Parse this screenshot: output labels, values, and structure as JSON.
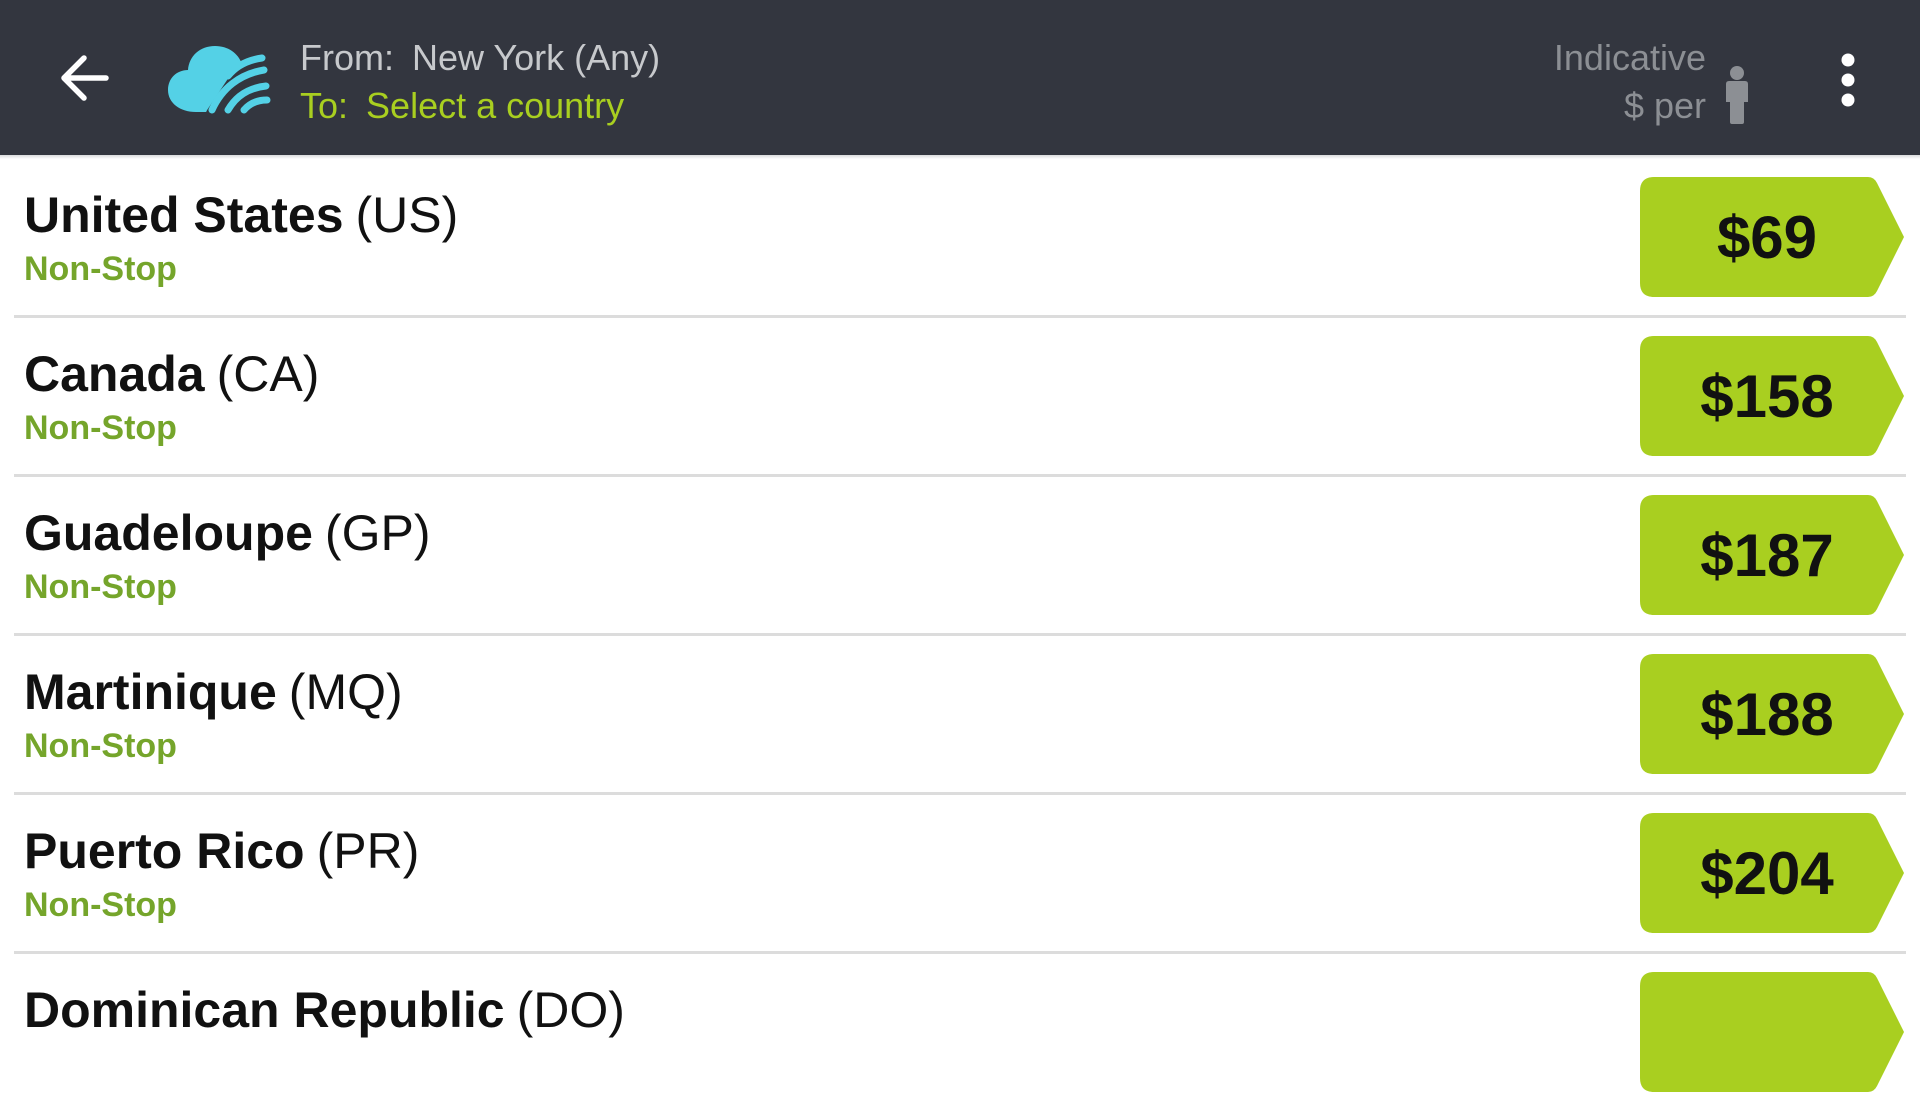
{
  "header": {
    "from_label": "From:",
    "from_value": "New York (Any)",
    "to_label": "To:",
    "to_value": "Select a country",
    "indicative_line1": "Indicative",
    "indicative_line2": "$ per",
    "icons": {
      "back": "arrow-back-icon",
      "logo": "skyscanner-cloud-logo",
      "person": "person-icon",
      "menu": "more-vertical-icon"
    }
  },
  "colors": {
    "appbar": "#33363f",
    "accent_green": "#a9cf20",
    "stop_green": "#75a52b",
    "logo_cyan": "#54d1e6"
  },
  "destinations": [
    {
      "country": "United States",
      "code": "(US)",
      "stops": "Non-Stop",
      "price": "$69"
    },
    {
      "country": "Canada",
      "code": "(CA)",
      "stops": "Non-Stop",
      "price": "$158"
    },
    {
      "country": "Guadeloupe",
      "code": "(GP)",
      "stops": "Non-Stop",
      "price": "$187"
    },
    {
      "country": "Martinique",
      "code": "(MQ)",
      "stops": "Non-Stop",
      "price": "$188"
    },
    {
      "country": "Puerto Rico",
      "code": "(PR)",
      "stops": "Non-Stop",
      "price": "$204"
    },
    {
      "country": "Dominican Republic",
      "code": "(DO)",
      "stops": "",
      "price": ""
    }
  ]
}
